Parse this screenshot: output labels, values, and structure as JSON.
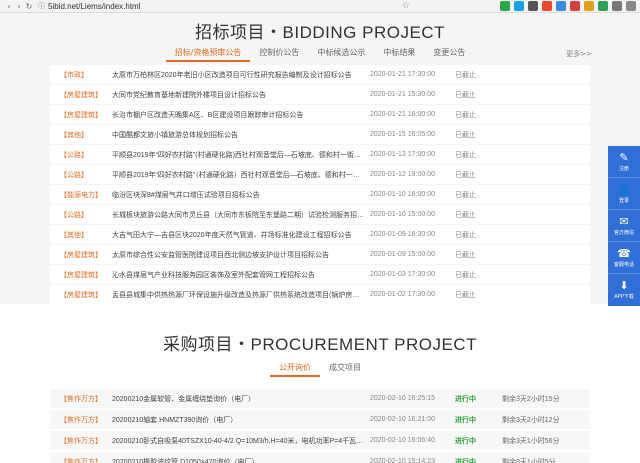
{
  "browser": {
    "url": "5ibid.net/Liems/index.html",
    "back_icon": "back-arrow-icon",
    "forward_icon": "forward-arrow-icon",
    "reload_icon": "reload-icon",
    "lock_icon": "lock-icon"
  },
  "bidding": {
    "title": "招标项目・BIDDING PROJECT",
    "tabs": [
      "招标/资格预审公告",
      "控制价公告",
      "中标候选公示",
      "中标结果",
      "变更公告"
    ],
    "more": "更多>>",
    "rows": [
      {
        "cat": "【市政】",
        "title": "太原市万柏林区2020年老旧小区改造项目可行性研究报告编制及设计招标公告",
        "date": "2020-01-21 17:30:00",
        "status": "已截止"
      },
      {
        "cat": "【房屋建筑】",
        "title": "大同市党纪教育基地新建院外楼项目设计招标公告",
        "date": "2020-01-21 15:30:00",
        "status": "已截止"
      },
      {
        "cat": "【房屋建筑】",
        "title": "长治市棚户区改造天晚集A区、B区建设项目跟踪审计招标公告",
        "date": "2020-01-21 18:00:00",
        "status": "已截止"
      },
      {
        "cat": "【其他】",
        "title": "中国酷都文旅小镇旅游总体规划招标公告",
        "date": "2020-01-15 16:05:00",
        "status": "已截止"
      },
      {
        "cat": "【公路】",
        "title": "平顺县2019年“四好农村路”(村通硬化路)西社村观音堂后—石坡底、德和村一街道等…",
        "date": "2020-01-13 17:00:00",
        "status": "已截止"
      },
      {
        "cat": "【公路】",
        "title": "平顺县2019年“四好农村路”（村通硬化路）西社村观音堂后—石坡底、德和村一街…",
        "date": "2020-01-12 19:00:00",
        "status": "已截止"
      },
      {
        "cat": "【能源电力】",
        "title": "临汾区块深8#煤层气井口增压试验项目招标公告",
        "date": "2020-01-10 16:00:00",
        "status": "已截止"
      },
      {
        "cat": "【公路】",
        "title": "长城板块旅游公路大同市灵丘县（大同市东板院至东堡路二期）试验检测服务招标…",
        "date": "2020-01-10 15:00:00",
        "status": "已截止"
      },
      {
        "cat": "【其他】",
        "title": "大吉气田大宁—吉县区块2020年度天然气管道、井场标准化建设工程招标公告",
        "date": "2020-01-09 16:30:00",
        "status": "已截止"
      },
      {
        "cat": "【房屋建筑】",
        "title": "太原市综合性公安监管医院建设项目西北侧边坡支护设计项目招标公告",
        "date": "2020-01-09 15:00:00",
        "status": "已截止"
      },
      {
        "cat": "【房屋建筑】",
        "title": "沁水县煤层气产业科技服务园区装饰及室外配套管网工程招标公告",
        "date": "2020-01-03 17:30:00",
        "status": "已截止"
      },
      {
        "cat": "【房屋建筑】",
        "title": "盂县县城集中供热热源厂环保设施升级改造及热源厂供热系统改造项目(锅炉房改造…",
        "date": "2020-01-02 17:30:00",
        "status": "已截止"
      }
    ]
  },
  "procurement": {
    "title": "采购项目・PROCUREMENT PROJECT",
    "tabs": [
      "公开询价",
      "成交项目"
    ],
    "rows": [
      {
        "cat": "【焦作万方】",
        "title": "20200210金属软管、金属缠绕垫询价（电厂）",
        "date": "2020-02-10 16:25:15",
        "status": "进行中",
        "remain": "剩余3天2小时15分"
      },
      {
        "cat": "【焦作万方】",
        "title": "20200210轴套 HNMZT390询价（电厂）",
        "date": "2020-02-10 16:21:00",
        "status": "进行中",
        "remain": "剩余3天2小时12分"
      },
      {
        "cat": "【焦作万方】",
        "title": "20200210卧式自吸泵40TSZX10-40-4/2 Q=10M3/h,H=40米，电机功率P=4千瓦，2…",
        "date": "2020-02-10 16:06:40",
        "status": "进行中",
        "remain": "剩余3天1小时56分"
      },
      {
        "cat": "【焦作万方】",
        "title": "20200210橡胶波纹管 D1050×470询价（电厂）",
        "date": "2020-02-10 15:14:23",
        "status": "进行中",
        "remain": "剩余3天1小时5分"
      }
    ]
  },
  "sidebar": [
    {
      "icon": "user-register-icon",
      "label": "注册"
    },
    {
      "icon": "login-icon",
      "label": "登录"
    },
    {
      "icon": "wechat-icon",
      "label": "官方微信"
    },
    {
      "icon": "phone-icon",
      "label": "客服电话"
    },
    {
      "icon": "android-icon",
      "label": "APP下载"
    }
  ]
}
